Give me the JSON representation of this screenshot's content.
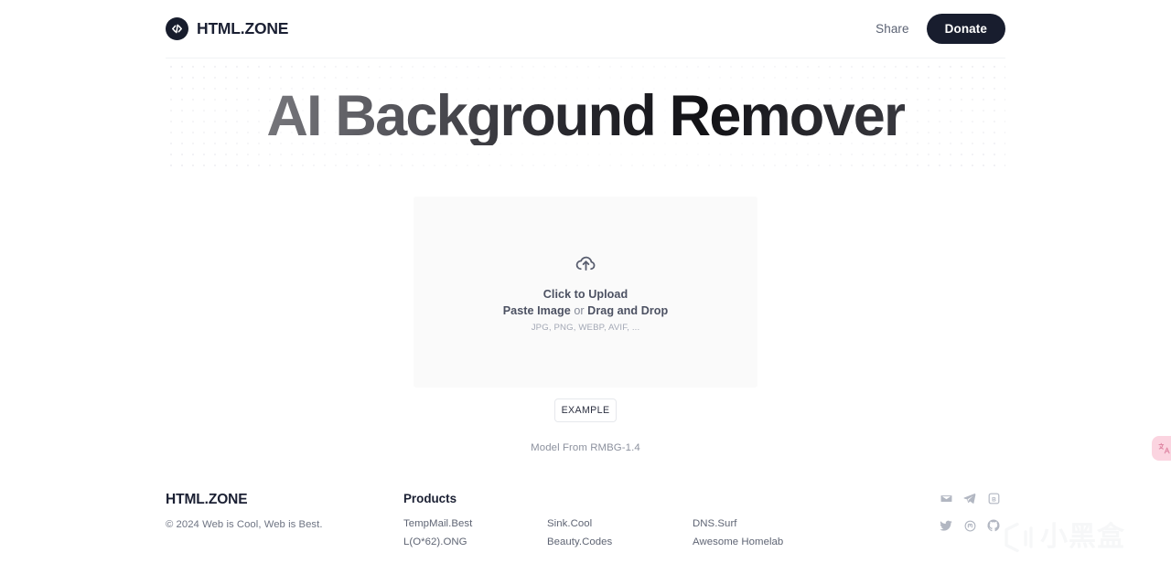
{
  "header": {
    "brand_name": "HTML.ZONE",
    "logo_icon": "code-brackets-icon",
    "share_label": "Share",
    "donate_label": "Donate",
    "donate_bg": "#181d2e"
  },
  "hero": {
    "title": "AI Background Remover"
  },
  "upload": {
    "icon": "cloud-upload-icon",
    "click_label": "Click to Upload",
    "paste_label": "Paste Image",
    "or_label": " or ",
    "drag_label": "Drag and Drop",
    "formats": "JPG, PNG, WEBP, AVIF, ...",
    "example_label": "EXAMPLE",
    "model_note": "Model From RMBG-1.4"
  },
  "footer": {
    "brand_name": "HTML.ZONE",
    "copyright": "© 2024 Web is Cool, Web is Best.",
    "products_heading": "Products",
    "product_columns": [
      {
        "links": [
          "TempMail.Best",
          "L(O*62).ONG"
        ]
      },
      {
        "links": [
          "Sink.Cool",
          "Beauty.Codes"
        ]
      },
      {
        "links": [
          "DNS.Surf",
          "Awesome Homelab"
        ]
      }
    ],
    "socials": [
      {
        "name": "email-icon",
        "label": "Email"
      },
      {
        "name": "telegram-icon",
        "label": "Telegram"
      },
      {
        "name": "blog-icon",
        "label": "Blog"
      },
      {
        "name": "twitter-icon",
        "label": "Twitter"
      },
      {
        "name": "mastodon-icon",
        "label": "Mastodon"
      },
      {
        "name": "github-icon",
        "label": "GitHub"
      }
    ]
  },
  "translate_widget": {
    "icon": "translate-icon",
    "color": "#fbd4e0"
  },
  "watermark": {
    "text": "小黑盒"
  }
}
